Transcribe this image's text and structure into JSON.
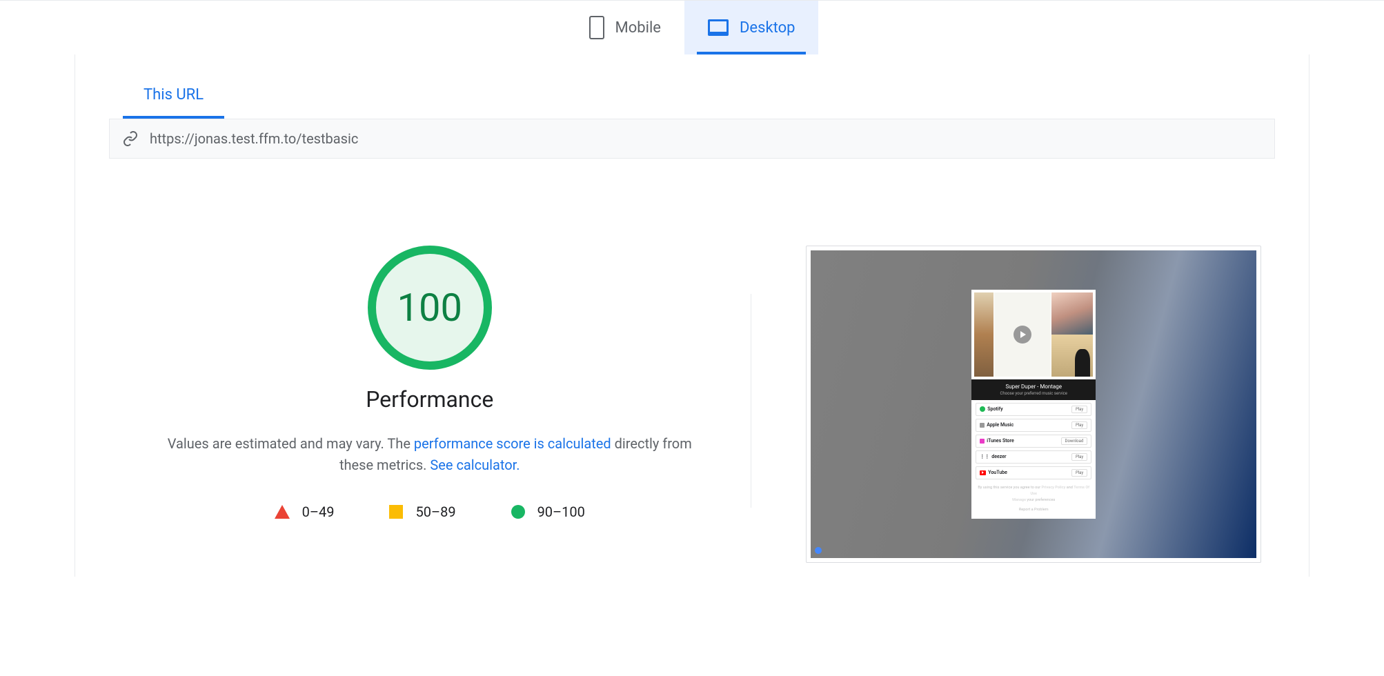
{
  "tabs": {
    "mobile": "Mobile",
    "desktop": "Desktop"
  },
  "urlTab": "This URL",
  "url": "https://jonas.test.ffm.to/testbasic",
  "score": "100",
  "performance": {
    "title": "Performance",
    "desc1": "Values are estimated and may vary. The ",
    "link1": "performance score is calculated",
    "desc2": " directly from these metrics. ",
    "link2": "See calculator."
  },
  "legend": {
    "red": "0–49",
    "orange": "50–89",
    "green": "90–100"
  },
  "preview": {
    "title": "Super Duper - Montage",
    "subtitle": "Choose your preferred music service",
    "services": [
      {
        "name": "Spotify",
        "action": "Play"
      },
      {
        "name": "Apple Music",
        "action": "Play"
      },
      {
        "name": "iTunes Store",
        "action": "Download"
      },
      {
        "name": "deezer",
        "action": "Play"
      },
      {
        "name": "YouTube",
        "action": "Play"
      }
    ],
    "footer1a": "By using this service you agree to our ",
    "footer1b": "Privacy Policy",
    "footer1c": " and ",
    "footer1d": "Terms Of Use",
    "footer2a": "Manage",
    "footer2b": " your preferences",
    "footer3": "Report a Problem"
  }
}
